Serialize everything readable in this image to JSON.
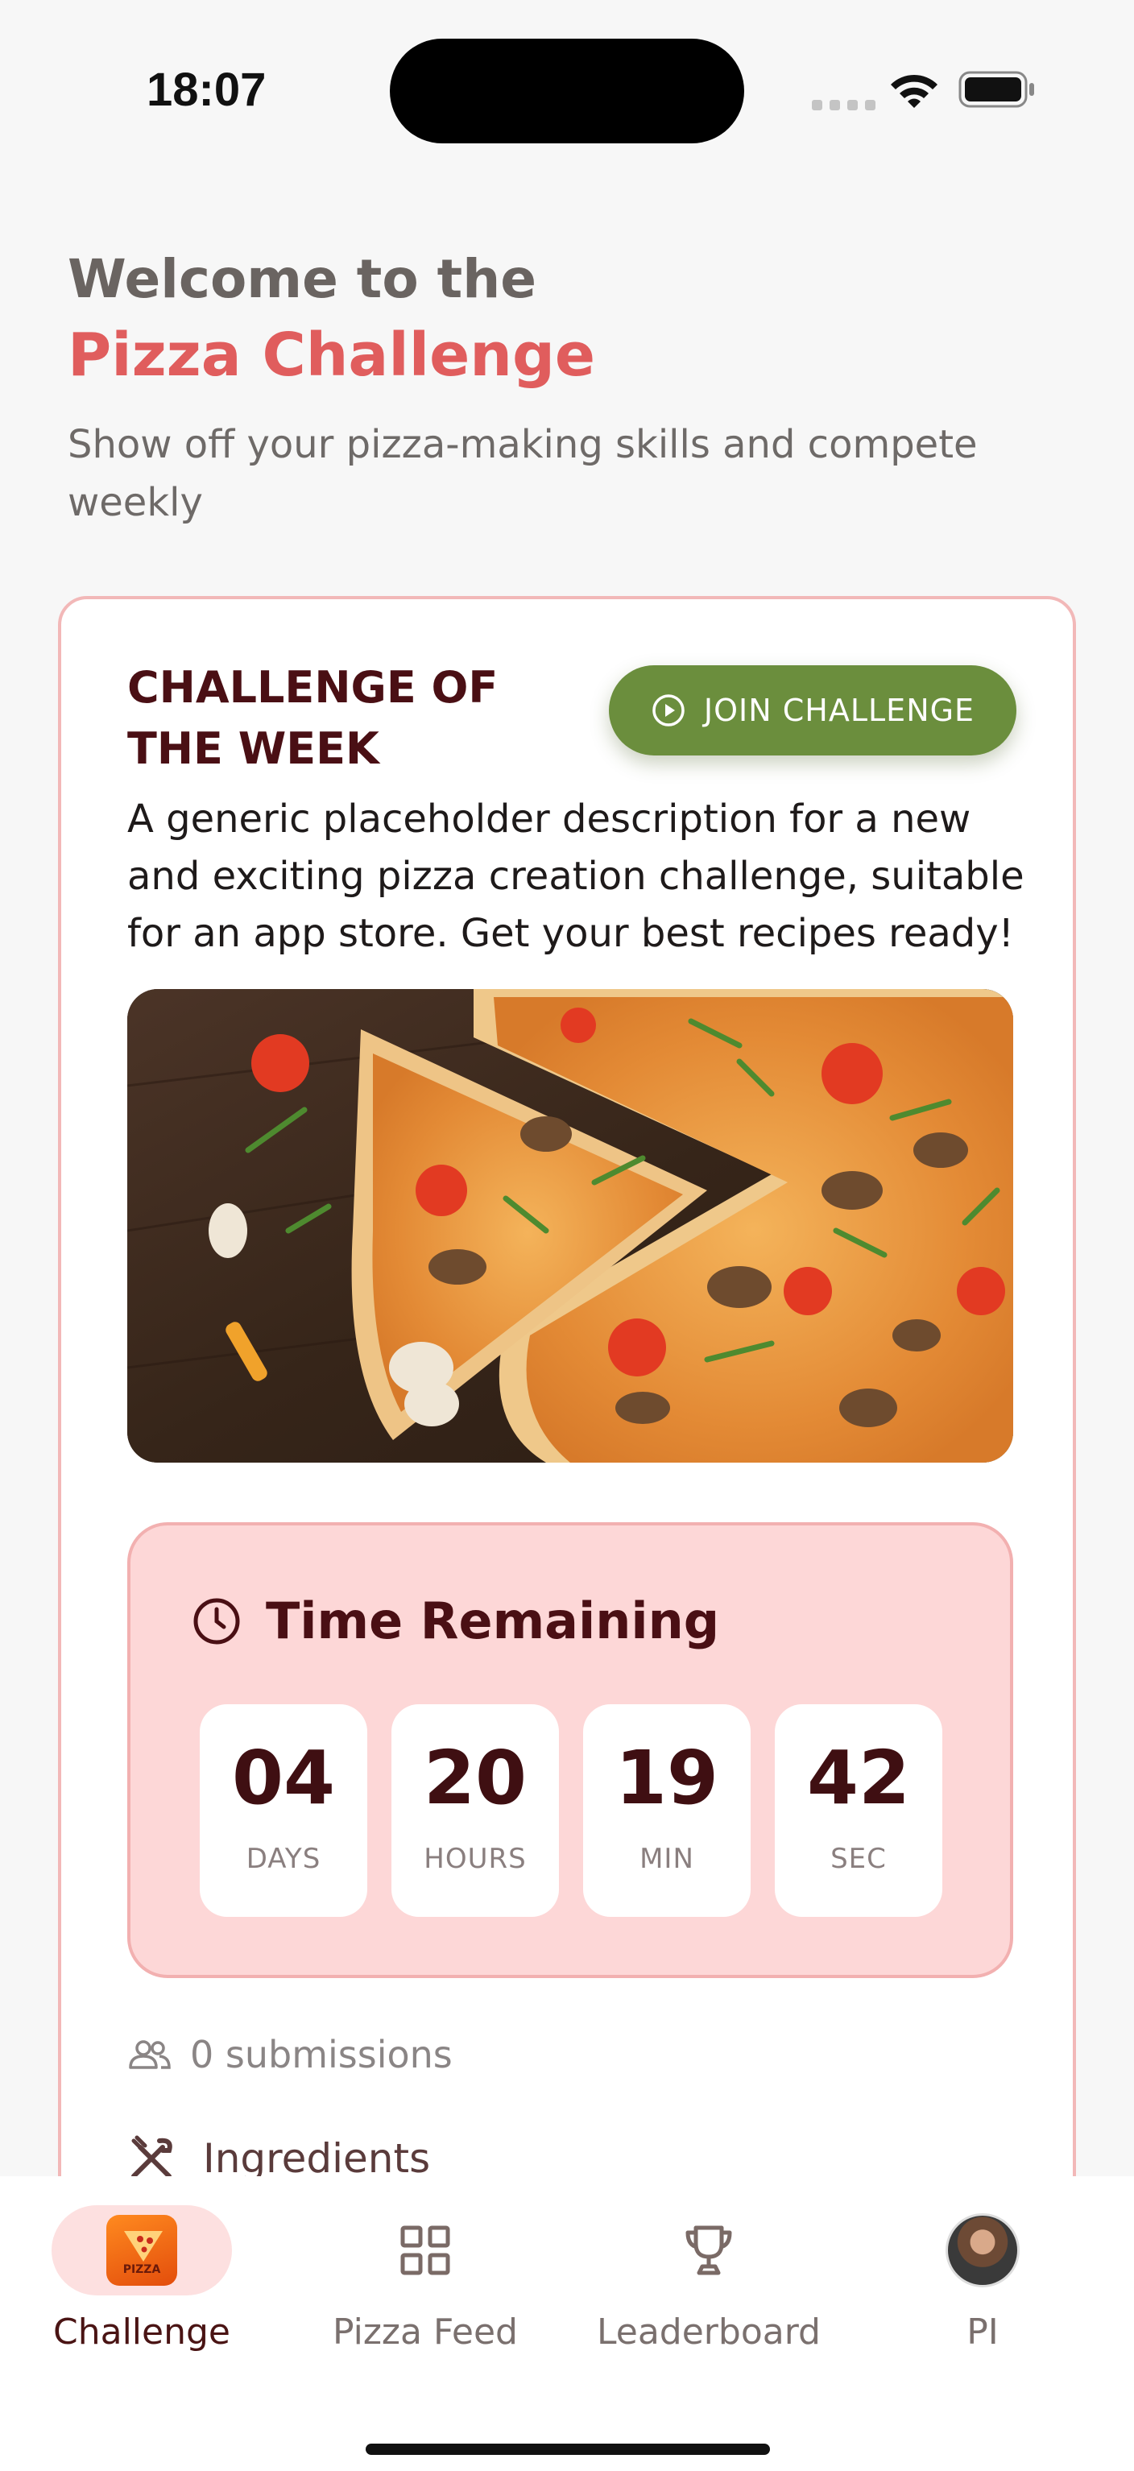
{
  "status_bar": {
    "time": "18:07"
  },
  "header": {
    "welcome": "Welcome to the",
    "title": "Pizza Challenge",
    "subtitle": "Show off your pizza-making skills and compete weekly"
  },
  "challenge": {
    "heading": "CHALLENGE OF THE WEEK",
    "join_label": "JOIN CHALLENGE",
    "description": "A generic placeholder description for a new and exciting pizza creation challenge, suitable for an app store. Get your best recipes ready!",
    "timer": {
      "title": "Time Remaining",
      "units": [
        {
          "value": "04",
          "label": "DAYS"
        },
        {
          "value": "20",
          "label": "HOURS"
        },
        {
          "value": "19",
          "label": "MIN"
        },
        {
          "value": "42",
          "label": "SEC"
        }
      ]
    },
    "submissions": "0 submissions",
    "ingredients": "Ingredients"
  },
  "nav": {
    "items": [
      {
        "label": "Challenge",
        "icon": "pizza-logo-icon"
      },
      {
        "label": "Pizza Feed",
        "icon": "grid-icon"
      },
      {
        "label": "Leaderboard",
        "icon": "trophy-icon"
      },
      {
        "label": "PI",
        "icon": "avatar"
      }
    ]
  },
  "colors": {
    "accent": "#e05d5d",
    "join_button": "#6b8e3d",
    "timer_bg": "#fdd7d7",
    "heading_dark": "#4a0f14"
  }
}
